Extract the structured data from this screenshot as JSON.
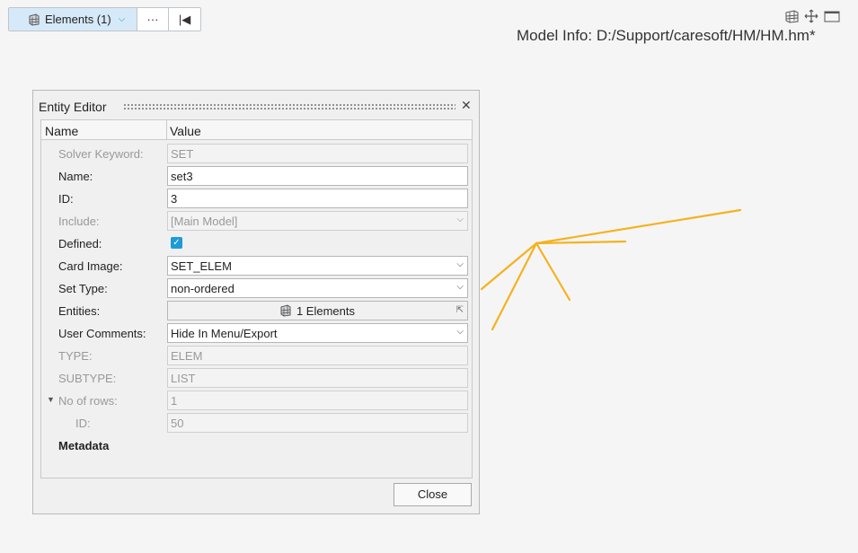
{
  "toolbar": {
    "entity_button_label": "Elements (1)",
    "more_label": "···",
    "first_label": "|◀"
  },
  "view_icons": [
    "grid-view-icon",
    "move-icon",
    "window-icon"
  ],
  "model_info": "Model Info: D:/Support/caresoft/HM/HM.hm*",
  "dialog": {
    "title": "Entity Editor",
    "close_label": "✕",
    "columns": {
      "name": "Name",
      "value": "Value"
    },
    "rows": {
      "solver_keyword": {
        "label": "Solver Keyword:",
        "value": "SET"
      },
      "name": {
        "label": "Name:",
        "value": "set3"
      },
      "id": {
        "label": "ID:",
        "value": "3"
      },
      "include": {
        "label": "Include:",
        "value": "[Main Model]"
      },
      "defined": {
        "label": "Defined:",
        "checked": true
      },
      "card_image": {
        "label": "Card Image:",
        "value": "SET_ELEM"
      },
      "set_type": {
        "label": "Set Type:",
        "value": "non-ordered"
      },
      "entities": {
        "label": "Entities:",
        "value": "1 Elements"
      },
      "user_comments": {
        "label": "User Comments:",
        "value": "Hide In Menu/Export"
      },
      "type": {
        "label": "TYPE:",
        "value": "ELEM"
      },
      "subtype": {
        "label": "SUBTYPE:",
        "value": "LIST"
      },
      "no_of_rows": {
        "label": "No of rows:",
        "value": "1"
      },
      "row_id": {
        "label": "ID:",
        "value": "50"
      },
      "metadata": {
        "label": "Metadata"
      }
    },
    "close_button_label": "Close"
  },
  "colors": {
    "accent": "#1d9bd7",
    "selection": "#d5e9f8",
    "mesh_lines": "#f5b21e"
  }
}
